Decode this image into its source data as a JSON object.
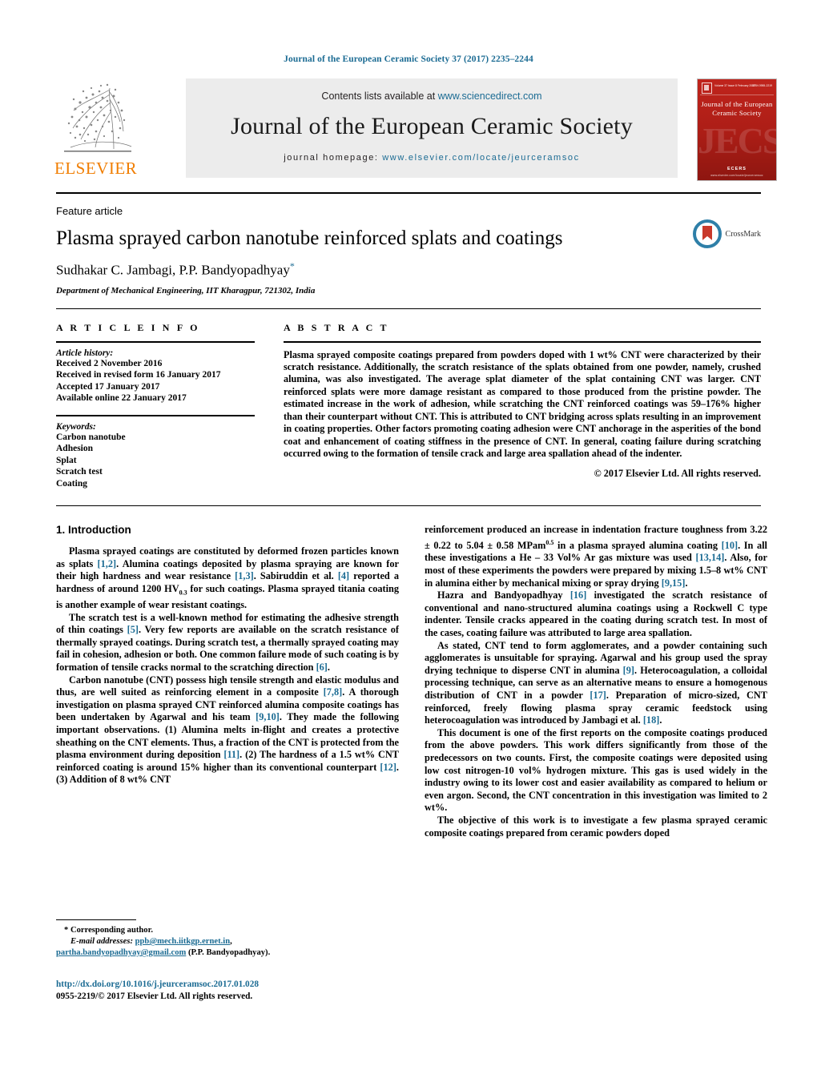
{
  "running_head": "Journal of the European Ceramic Society 37 (2017) 2235–2244",
  "masthead": {
    "contents_prefix": "Contents lists available at",
    "contents_link": "www.sciencedirect.com",
    "journal_title": "Journal of the European Ceramic Society",
    "homepage_prefix": "journal homepage:",
    "homepage_link": "www.elsevier.com/locate/jeurceramsoc",
    "publisher_name": "ELSEVIER",
    "cover": {
      "top_left_text": "Volume 37  Issue 8  February 2017",
      "top_right_text": "ISSN 0955-2219",
      "title": "Journal of the European Ceramic Society",
      "watermark": "JECS",
      "footer": "ECERS",
      "footer_sub": "www.elsevier.com/locate/jeurceramsoc"
    }
  },
  "article": {
    "kicker": "Feature article",
    "title": "Plasma sprayed carbon nanotube reinforced splats and coatings",
    "authors": "Sudhakar C. Jambagi, P.P. Bandyopadhyay",
    "corresponding_marker": "*",
    "affiliation": "Department of Mechanical Engineering, IIT Kharagpur, 721302, India",
    "crossmark_label": "CrossMark"
  },
  "info": {
    "heading": "A R T I C L E   I N F O",
    "history_title": "Article history:",
    "history": [
      "Received 2 November 2016",
      "Received in revised form 16 January 2017",
      "Accepted 17 January 2017",
      "Available online 22 January 2017"
    ],
    "keywords_title": "Keywords:",
    "keywords": [
      "Carbon nanotube",
      "Adhesion",
      "Splat",
      "Scratch test",
      "Coating"
    ]
  },
  "abstract": {
    "heading": "A B S T R A C T",
    "text": "Plasma sprayed composite coatings prepared from powders doped with 1 wt% CNT were characterized by their scratch resistance. Additionally, the scratch resistance of the splats obtained from one powder, namely, crushed alumina, was also investigated. The average splat diameter of the splat containing CNT was larger. CNT reinforced splats were more damage resistant as compared to those produced from the pristine powder. The estimated increase in the work of adhesion, while scratching the CNT reinforced coatings was 59–176% higher than their counterpart without CNT. This is attributed to CNT bridging across splats resulting in an improvement in coating properties. Other factors promoting coating adhesion were CNT anchorage in the asperities of the bond coat and enhancement of coating stiffness in the presence of CNT. In general, coating failure during scratching occurred owing to the formation of tensile crack and large area spallation ahead of the indenter.",
    "copyright": "© 2017 Elsevier Ltd. All rights reserved."
  },
  "body": {
    "section_heading": "1.  Introduction",
    "left_paragraphs": [
      "Plasma sprayed coatings are constituted by deformed frozen particles known as splats [1,2]. Alumina coatings deposited by plasma spraying are known for their high hardness and wear resistance [1,3]. Sabiruddin et al. [4] reported a hardness of around 1200 HV0.3 for such coatings. Plasma sprayed titania coating is another example of wear resistant coatings.",
      "The scratch test is a well-known method for estimating the adhesive strength of thin coatings [5]. Very few reports are available on the scratch resistance of thermally sprayed coatings. During scratch test, a thermally sprayed coating may fail in cohesion, adhesion or both. One common failure mode of such coating is by formation of tensile cracks normal to the scratching direction [6].",
      "Carbon nanotube (CNT) possess high tensile strength and elastic modulus and thus, are well suited as reinforcing element in a composite [7,8]. A thorough investigation on plasma sprayed CNT reinforced alumina composite coatings has been undertaken by Agarwal and his team [9,10]. They made the following important observations. (1) Alumina melts in-flight and creates a protective sheathing on the CNT elements. Thus, a fraction of the CNT is protected from the plasma environment during deposition [11]. (2) The hardness of a 1.5 wt% CNT reinforced coating is around 15% higher than its conventional counterpart [12]. (3) Addition of 8 wt% CNT"
    ],
    "right_paragraphs": [
      "reinforcement produced an increase in indentation fracture toughness from 3.22 ± 0.22 to 5.04 ± 0.58 MPam0.5 in a plasma sprayed alumina coating [10]. In all these investigations a He – 33 Vol% Ar gas mixture was used [13,14]. Also, for most of these experiments the powders were prepared by mixing 1.5–8 wt% CNT in alumina either by mechanical mixing or spray drying [9,15].",
      "Hazra and Bandyopadhyay [16] investigated the scratch resistance of conventional and nano-structured alumina coatings using a Rockwell C type indenter. Tensile cracks appeared in the coating during scratch test. In most of the cases, coating failure was attributed to large area spallation.",
      "As stated, CNT tend to form agglomerates, and a powder containing such agglomerates is unsuitable for spraying. Agarwal and his group used the spray drying technique to disperse CNT in alumina [9]. Heterocoagulation, a colloidal processing technique, can serve as an alternative means to ensure a homogenous distribution of CNT in a powder [17]. Preparation of micro-sized, CNT reinforced, freely flowing plasma spray ceramic feedstock using heterocoagulation was introduced by Jambagi et al. [18].",
      "This document is one of the first reports on the composite coatings produced from the above powders. This work differs significantly from those of the predecessors on two counts. First, the composite coatings were deposited using low cost nitrogen-10 vol% hydrogen mixture. This gas is used widely in the industry owing to its lower cost and easier availability as compared to helium or even argon. Second, the CNT concentration in this investigation was limited to 2 wt%.",
      "The objective of this work is to investigate a few plasma sprayed ceramic composite coatings prepared from ceramic powders doped"
    ]
  },
  "footnote": {
    "corresponding": "* Corresponding author.",
    "email_label": "E-mail addresses:",
    "email1": "ppb@mech.iitkgp.ernet.in",
    "email2": "partha.bandyopadhyay@gmail.com",
    "email_owner": "(P.P. Bandyopadhyay).",
    "doi": "http://dx.doi.org/10.1016/j.jeurceramsoc.2017.01.028",
    "issn": "0955-2219/© 2017 Elsevier Ltd. All rights reserved."
  },
  "colors": {
    "link": "#1b6b93",
    "elsevier_orange": "#f07d00",
    "cover_red": "#ab1d16"
  }
}
